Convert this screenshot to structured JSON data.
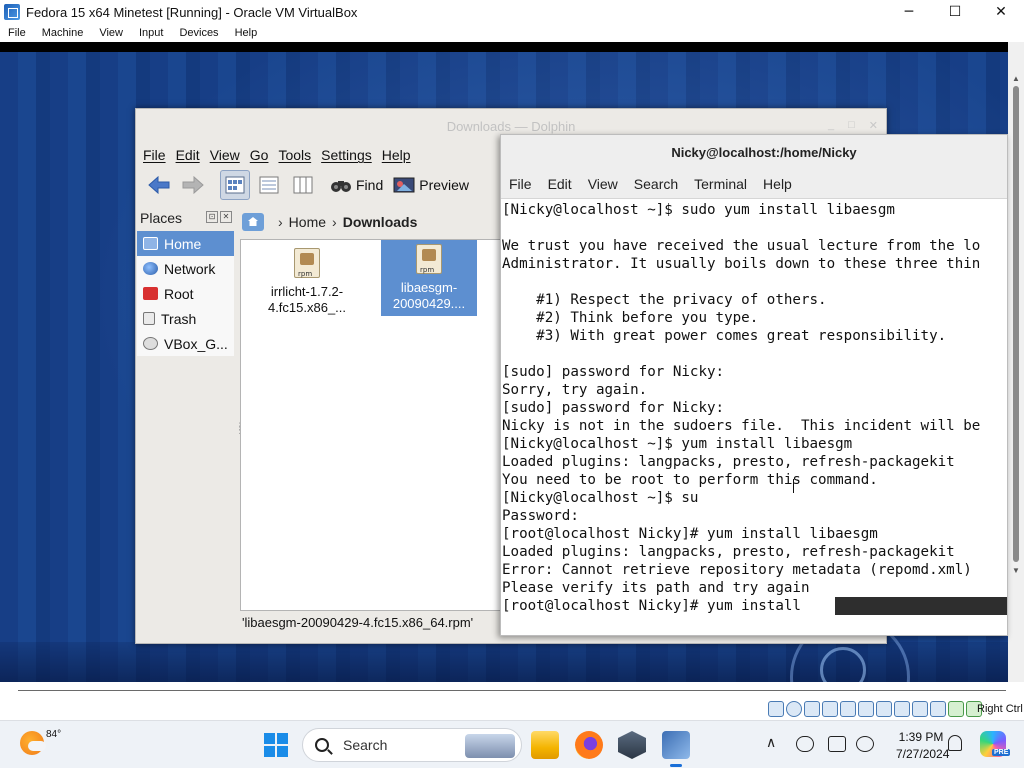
{
  "host_window": {
    "title": "Fedora 15 x64 Minetest [Running] - Oracle VM VirtualBox",
    "controls": {
      "minimize": "─",
      "maximize": "☐",
      "close": "✕"
    },
    "menu": [
      "File",
      "Machine",
      "View",
      "Input",
      "Devices",
      "Help"
    ]
  },
  "dolphin": {
    "title": "Downloads — Dolphin",
    "title_buttons": [
      "_",
      "□",
      "✕"
    ],
    "menu": [
      "File",
      "Edit",
      "View",
      "Go",
      "Tools",
      "Settings",
      "Help"
    ],
    "toolbar": {
      "find": "Find",
      "preview": "Preview"
    },
    "places": {
      "header": "Places",
      "items": [
        {
          "label": "Home",
          "selected": true
        },
        {
          "label": "Network",
          "selected": false
        },
        {
          "label": "Root",
          "selected": false
        },
        {
          "label": "Trash",
          "selected": false
        },
        {
          "label": "VBox_G...",
          "selected": false
        }
      ]
    },
    "breadcrumb": {
      "home": "Home",
      "current": "Downloads",
      "sep": "›"
    },
    "files": [
      {
        "line1": "irrlicht-1.7.2-",
        "line2": "4.fc15.x86_...",
        "selected": false
      },
      {
        "line1": "libaesgm-",
        "line2": "20090429....",
        "selected": true
      }
    ],
    "status": "'libaesgm-20090429-4.fc15.x86_64.rpm'"
  },
  "terminal": {
    "title": "Nicky@localhost:/home/Nicky",
    "menu": [
      "File",
      "Edit",
      "View",
      "Search",
      "Terminal",
      "Help"
    ],
    "lines": [
      "[Nicky@localhost ~]$ sudo yum install libaesgm",
      "",
      "We trust you have received the usual lecture from the lo",
      "Administrator. It usually boils down to these three thin",
      "",
      "    #1) Respect the privacy of others.",
      "    #2) Think before you type.",
      "    #3) With great power comes great responsibility.",
      "",
      "[sudo] password for Nicky:",
      "Sorry, try again.",
      "[sudo] password for Nicky:",
      "Nicky is not in the sudoers file.  This incident will be",
      "[Nicky@localhost ~]$ yum install libaesgm",
      "Loaded plugins: langpacks, presto, refresh-packagekit",
      "You need to be root to perform this command.",
      "[Nicky@localhost ~]$ su",
      "Password:",
      "[root@localhost Nicky]# yum install libaesgm",
      "Loaded plugins: langpacks, presto, refresh-packagekit",
      "Error: Cannot retrieve repository metadata (repomd.xml)",
      "Please verify its path and try again",
      "[root@localhost Nicky]# yum install"
    ]
  },
  "vbox_status": {
    "host_key": "Right Ctrl"
  },
  "taskbar": {
    "weather_temp": "84°",
    "search_placeholder": "Search",
    "time": "1:39 PM",
    "date": "7/27/2024",
    "copilot_badge": "PRE"
  },
  "colors": {
    "selection": "#5d8fd0",
    "desktop": "#12397c",
    "windows_accent": "#1a8ce8"
  }
}
